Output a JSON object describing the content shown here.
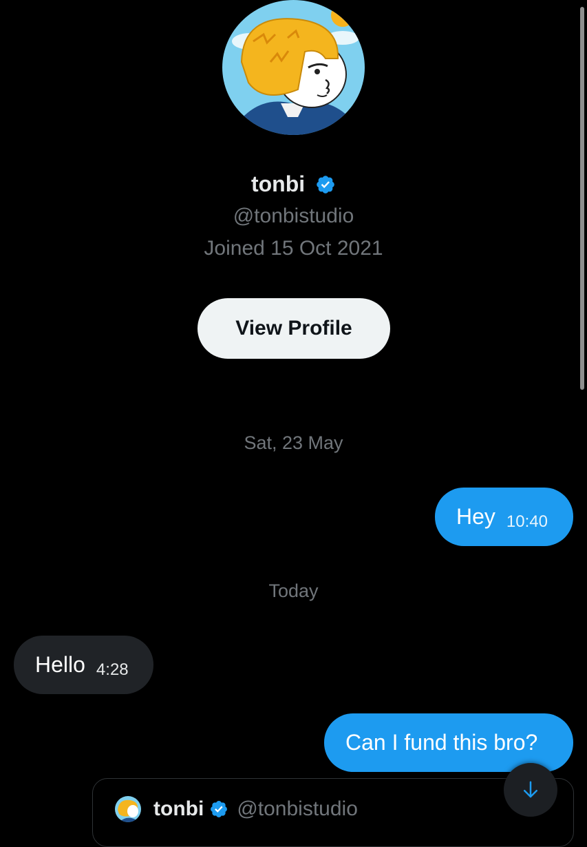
{
  "profile": {
    "name": "tonbi",
    "handle": "@tonbistudio",
    "joined": "Joined 15 Oct 2021",
    "view_profile_label": "View Profile"
  },
  "messages": [
    {
      "type": "date",
      "text": "Sat, 23 May"
    },
    {
      "type": "sent",
      "text": "Hey",
      "time": "10:40"
    },
    {
      "type": "date",
      "text": "Today"
    },
    {
      "type": "received",
      "text": "Hello",
      "time": "4:28"
    },
    {
      "type": "sent",
      "text": "Can I fund this bro?"
    }
  ],
  "quoted_post": {
    "name": "tonbi",
    "handle": "@tonbistudio"
  },
  "icons": {
    "verified": "verified-badge-icon",
    "scroll_down": "arrow-down-icon"
  },
  "colors": {
    "accent": "#1d9bf0",
    "background": "#000000",
    "received_bubble": "#202327",
    "view_profile_button": "#eff3f4"
  }
}
